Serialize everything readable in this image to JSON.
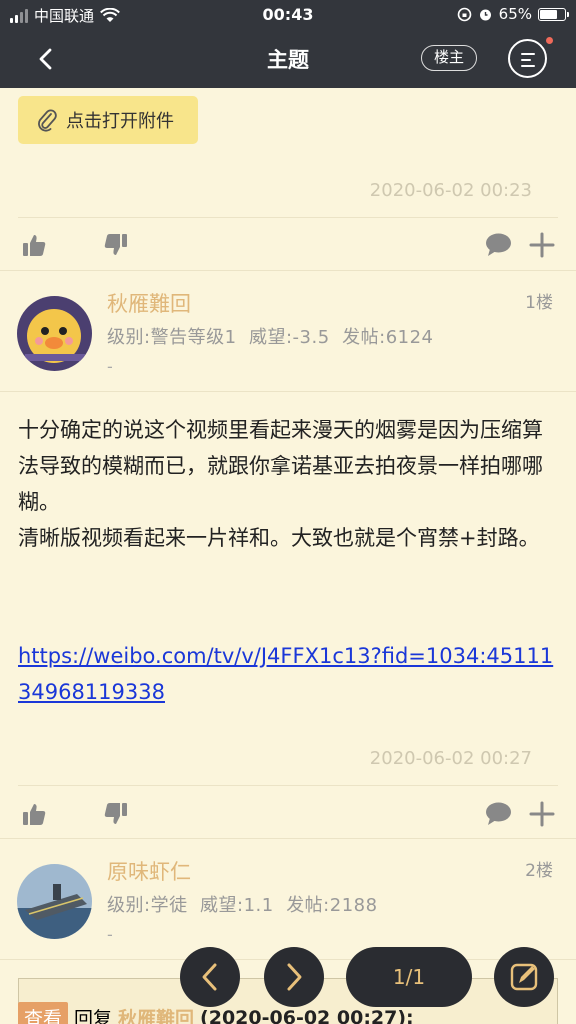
{
  "status_bar": {
    "carrier": "中国联通",
    "time": "00:43",
    "battery": "65%"
  },
  "nav": {
    "title": "主题",
    "louzhu_button": "楼主"
  },
  "prev_post": {
    "attachment_button": "点击打开附件",
    "timestamp": "2020-06-02 00:23"
  },
  "posts": [
    {
      "username": "秋雁難回",
      "level": "级别:警告等级1",
      "reputation": "威望:-3.5",
      "post_count": "发帖:6124",
      "dash": "-",
      "floor": "1楼",
      "text": "十分确定的说这个视频里看起来漫天的烟雾是因为压缩算法导致的模糊而已，就跟你拿诺基亚去拍夜景一样拍哪哪糊。\n清晰版视频看起来一片祥和。大致也就是个宵禁+封路。",
      "link": "https://weibo.com/tv/v/J4FFX1c13?fid=1034:4511134968119338",
      "timestamp": "2020-06-02 00:27"
    },
    {
      "username": "原味虾仁",
      "level": "级别:学徒",
      "reputation": "威望:1.1",
      "post_count": "发帖:2188",
      "dash": "-",
      "floor": "2楼"
    }
  ],
  "quote": {
    "tag": "查看",
    "reply_label": "回复",
    "name": "秋雁難回",
    "time": "(2020-06-02 00:27):"
  },
  "pager": {
    "label": "1/1"
  },
  "colors": {
    "header_bg": "#33363c",
    "page_bg": "#fbf5dc",
    "username": "#e0b77a",
    "link": "#1a37d8",
    "attach_bg": "#f8e58b"
  },
  "icons": [
    "back-arrow-icon",
    "menu-icon",
    "paperclip-icon",
    "thumbs-up-icon",
    "thumbs-down-icon",
    "comment-icon",
    "plus-icon",
    "prev-page-icon",
    "next-page-icon",
    "compose-icon"
  ]
}
